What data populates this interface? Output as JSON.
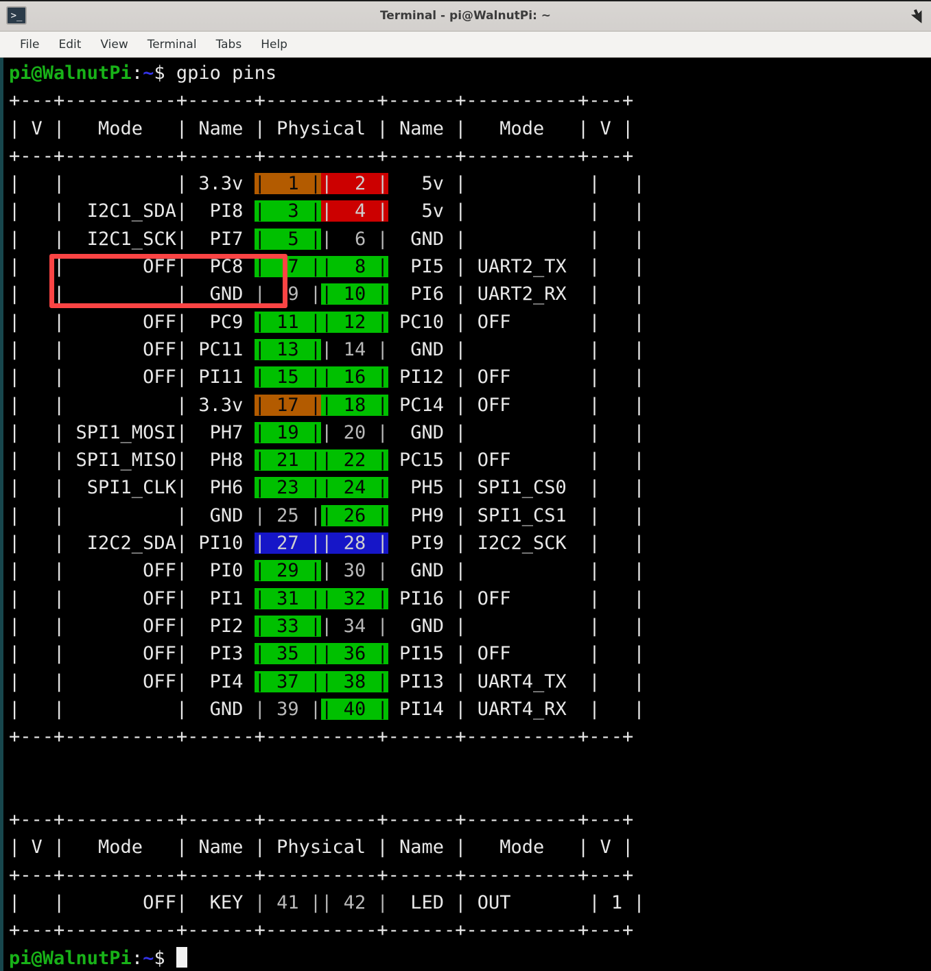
{
  "window": {
    "title": "Terminal - pi@WalnutPi: ~",
    "app_icon": ">_",
    "cursor_icon": "mouse-pointer"
  },
  "menubar": {
    "items": [
      {
        "label": "File"
      },
      {
        "label": "Edit"
      },
      {
        "label": "View"
      },
      {
        "label": "Terminal"
      },
      {
        "label": "Tabs"
      },
      {
        "label": "Help"
      }
    ]
  },
  "terminal": {
    "prompt_user": "pi@WalnutPi",
    "prompt_path": ":~$",
    "command": "gpio pins",
    "final_prompt_user": "pi@WalnutPi",
    "final_prompt_path": ":~$",
    "rule": "+---+----------+------+----------+------+----------+---+",
    "header": {
      "v_left": "V",
      "mode_left": "Mode",
      "name_left": "Name",
      "physical": "Physical",
      "name_right": "Name",
      "mode_right": "Mode",
      "v_right": "V"
    },
    "colors": {
      "power_33v": "#b35b00",
      "power_5v": "#cc0000",
      "gpio": "#00c000",
      "i2c2": "#1616c8",
      "ground": "#000000",
      "annotation": "#fb4444",
      "prompt_green": "#18b218",
      "prompt_blue": "#3333e6"
    },
    "rows": [
      {
        "v_l": "",
        "mode_l": "",
        "name_l": "3.3v",
        "pin_l": "1",
        "pin_l_bg": "orng",
        "pin_r": "2",
        "pin_r_bg": "red",
        "name_r": "5v",
        "mode_r": "",
        "v_r": ""
      },
      {
        "v_l": "",
        "mode_l": "I2C1_SDA",
        "name_l": "PI8",
        "pin_l": "3",
        "pin_l_bg": "green",
        "pin_r": "4",
        "pin_r_bg": "red",
        "name_r": "5v",
        "mode_r": "",
        "v_r": ""
      },
      {
        "v_l": "",
        "mode_l": "I2C1_SCK",
        "name_l": "PI7",
        "pin_l": "5",
        "pin_l_bg": "green",
        "pin_r": "6",
        "pin_r_bg": "blk",
        "name_r": "GND",
        "mode_r": "",
        "v_r": ""
      },
      {
        "v_l": "",
        "mode_l": "OFF",
        "name_l": "PC8",
        "pin_l": "7",
        "pin_l_bg": "green",
        "pin_r": "8",
        "pin_r_bg": "green",
        "name_r": "PI5",
        "mode_r": "UART2_TX",
        "v_r": ""
      },
      {
        "v_l": "",
        "mode_l": "",
        "name_l": "GND",
        "pin_l": "9",
        "pin_l_bg": "blk",
        "pin_r": "10",
        "pin_r_bg": "green",
        "name_r": "PI6",
        "mode_r": "UART2_RX",
        "v_r": ""
      },
      {
        "v_l": "",
        "mode_l": "OFF",
        "name_l": "PC9",
        "pin_l": "11",
        "pin_l_bg": "green",
        "pin_r": "12",
        "pin_r_bg": "green",
        "name_r": "PC10",
        "mode_r": "OFF",
        "v_r": ""
      },
      {
        "v_l": "",
        "mode_l": "OFF",
        "name_l": "PC11",
        "pin_l": "13",
        "pin_l_bg": "green",
        "pin_r": "14",
        "pin_r_bg": "blk",
        "name_r": "GND",
        "mode_r": "",
        "v_r": ""
      },
      {
        "v_l": "",
        "mode_l": "OFF",
        "name_l": "PI11",
        "pin_l": "15",
        "pin_l_bg": "green",
        "pin_r": "16",
        "pin_r_bg": "green",
        "name_r": "PI12",
        "mode_r": "OFF",
        "v_r": ""
      },
      {
        "v_l": "",
        "mode_l": "",
        "name_l": "3.3v",
        "pin_l": "17",
        "pin_l_bg": "orng",
        "pin_r": "18",
        "pin_r_bg": "green",
        "name_r": "PC14",
        "mode_r": "OFF",
        "v_r": ""
      },
      {
        "v_l": "",
        "mode_l": "SPI1_MOSI",
        "name_l": "PH7",
        "pin_l": "19",
        "pin_l_bg": "green",
        "pin_r": "20",
        "pin_r_bg": "blk",
        "name_r": "GND",
        "mode_r": "",
        "v_r": ""
      },
      {
        "v_l": "",
        "mode_l": "SPI1_MISO",
        "name_l": "PH8",
        "pin_l": "21",
        "pin_l_bg": "green",
        "pin_r": "22",
        "pin_r_bg": "green",
        "name_r": "PC15",
        "mode_r": "OFF",
        "v_r": ""
      },
      {
        "v_l": "",
        "mode_l": "SPI1_CLK",
        "name_l": "PH6",
        "pin_l": "23",
        "pin_l_bg": "green",
        "pin_r": "24",
        "pin_r_bg": "green",
        "name_r": "PH5",
        "mode_r": "SPI1_CS0",
        "v_r": ""
      },
      {
        "v_l": "",
        "mode_l": "",
        "name_l": "GND",
        "pin_l": "25",
        "pin_l_bg": "blk",
        "pin_r": "26",
        "pin_r_bg": "green",
        "name_r": "PH9",
        "mode_r": "SPI1_CS1",
        "v_r": ""
      },
      {
        "v_l": "",
        "mode_l": "I2C2_SDA",
        "name_l": "PI10",
        "pin_l": "27",
        "pin_l_bg": "blue",
        "pin_r": "28",
        "pin_r_bg": "blue",
        "name_r": "PI9",
        "mode_r": "I2C2_SCK",
        "v_r": ""
      },
      {
        "v_l": "",
        "mode_l": "OFF",
        "name_l": "PI0",
        "pin_l": "29",
        "pin_l_bg": "green",
        "pin_r": "30",
        "pin_r_bg": "blk",
        "name_r": "GND",
        "mode_r": "",
        "v_r": ""
      },
      {
        "v_l": "",
        "mode_l": "OFF",
        "name_l": "PI1",
        "pin_l": "31",
        "pin_l_bg": "green",
        "pin_r": "32",
        "pin_r_bg": "green",
        "name_r": "PI16",
        "mode_r": "OFF",
        "v_r": ""
      },
      {
        "v_l": "",
        "mode_l": "OFF",
        "name_l": "PI2",
        "pin_l": "33",
        "pin_l_bg": "green",
        "pin_r": "34",
        "pin_r_bg": "blk",
        "name_r": "GND",
        "mode_r": "",
        "v_r": ""
      },
      {
        "v_l": "",
        "mode_l": "OFF",
        "name_l": "PI3",
        "pin_l": "35",
        "pin_l_bg": "green",
        "pin_r": "36",
        "pin_r_bg": "green",
        "name_r": "PI15",
        "mode_r": "OFF",
        "v_r": ""
      },
      {
        "v_l": "",
        "mode_l": "OFF",
        "name_l": "PI4",
        "pin_l": "37",
        "pin_l_bg": "green",
        "pin_r": "38",
        "pin_r_bg": "green",
        "name_r": "PI13",
        "mode_r": "UART4_TX",
        "v_r": ""
      },
      {
        "v_l": "",
        "mode_l": "",
        "name_l": "GND",
        "pin_l": "39",
        "pin_l_bg": "blk",
        "pin_r": "40",
        "pin_r_bg": "green",
        "name_r": "PI14",
        "mode_r": "UART4_RX",
        "v_r": ""
      }
    ],
    "rows2": [
      {
        "v_l": "",
        "mode_l": "OFF",
        "name_l": "KEY",
        "pin_l": "41",
        "pin_l_bg": "blk",
        "pin_r": "42",
        "pin_r_bg": "blk",
        "name_r": "LED",
        "mode_r": "OUT",
        "v_r": "1"
      }
    ]
  },
  "annotation": {
    "label": "highlight-i2c1-rows",
    "color": "#fb4444"
  }
}
